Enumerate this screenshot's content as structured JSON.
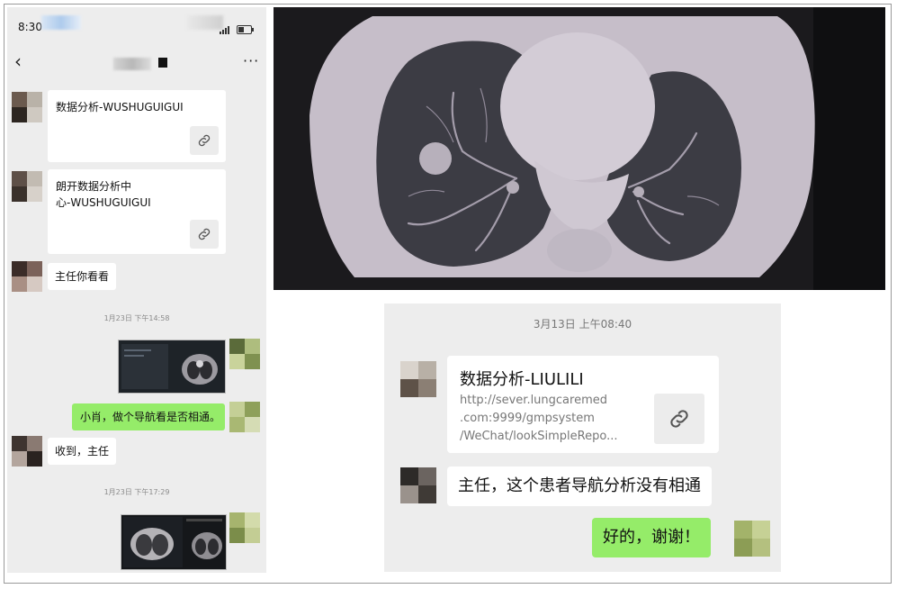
{
  "left_chat": {
    "status_time": "8:30",
    "messages": [
      {
        "type": "link-card",
        "title": "数据分析-WUSHUGUIGUI"
      },
      {
        "type": "link-card",
        "title_line1": "朗开数据分析中",
        "title_line2": "心-WUSHUGUIGUI"
      },
      {
        "type": "text",
        "text": "主任你看看"
      },
      {
        "type": "timestamp",
        "text": "1月23日 下午14:58"
      },
      {
        "type": "image",
        "side": "right"
      },
      {
        "type": "text",
        "side": "right",
        "text": "小肖，做个导航看是否相通。"
      },
      {
        "type": "text",
        "text": "收到，主任"
      },
      {
        "type": "timestamp",
        "text": "1月23日 下午17:29"
      },
      {
        "type": "image",
        "side": "right"
      }
    ]
  },
  "right_chat": {
    "timestamp": "3月13日 上午08:40",
    "card": {
      "title": "数据分析-LIULILI",
      "url_line1": "http://sever.lungcaremed",
      "url_line2": ".com:9999/gmpsystem",
      "url_line3": "/WeChat/lookSimpleRepo..."
    },
    "message1": "主任，这个患者导航分析没有相通",
    "reply": "好的，谢谢！"
  },
  "colors": {
    "chat_background": "#ededed",
    "sent_bubble": "#95ec69",
    "received_bubble": "#ffffff",
    "ct_background": "#1b1a1d"
  },
  "icons": [
    "back-icon",
    "more-icon",
    "link-icon",
    "signal-icon",
    "battery-icon"
  ]
}
